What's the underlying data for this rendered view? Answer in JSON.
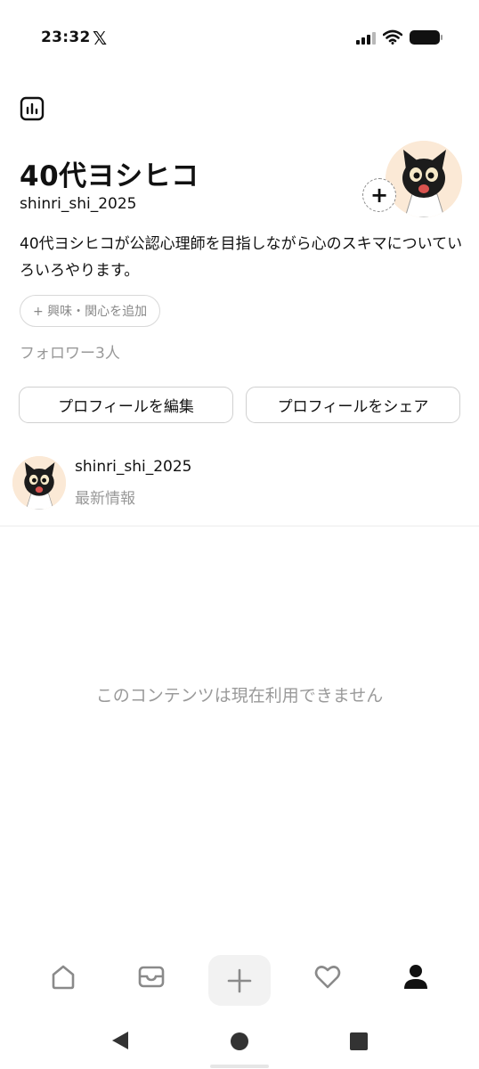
{
  "status_bar": {
    "time": "23:32",
    "app_icon": "𝕏"
  },
  "profile": {
    "display_name": "40代ヨシヒコ",
    "handle": "shinri_shi_2025",
    "bio": "40代ヨシヒコが公認心理師を目指しながら心のスキマについていろいろやります。",
    "interest_chip": "+ 興味・関心を追加",
    "followers": "フォロワー3人",
    "edit_button": "プロフィールを編集",
    "share_button": "プロフィールをシェア",
    "add_badge": "+"
  },
  "feed": {
    "handle": "shinri_shi_2025",
    "subtitle": "最新情報"
  },
  "empty_state": "このコンテンツは現在利用できません",
  "icons": {
    "insights": "insights-icon",
    "home": "home-icon",
    "inbox": "inbox-icon",
    "create": "plus-icon",
    "activity": "heart-icon",
    "profile": "person-icon"
  },
  "colors": {
    "text": "#111111",
    "muted": "#999999",
    "border": "#d0d0d0"
  }
}
